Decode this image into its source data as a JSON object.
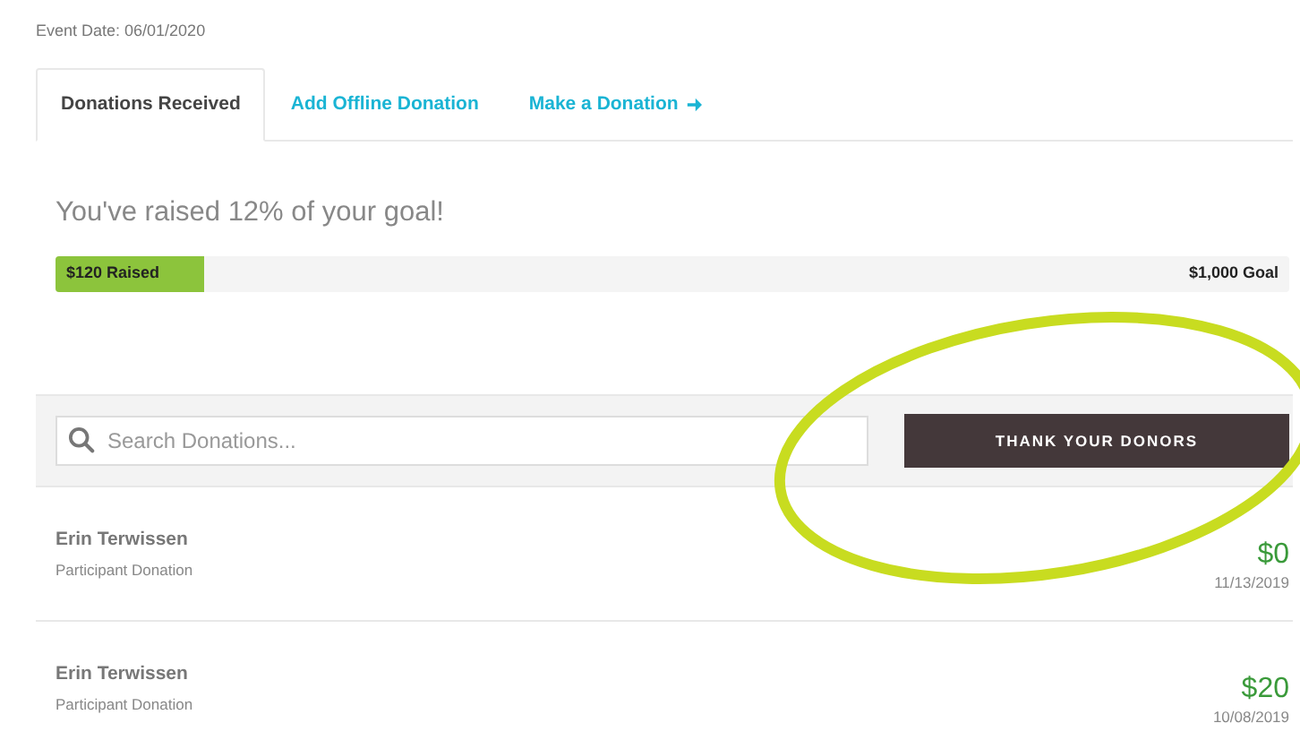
{
  "event_date": "Event Date: 06/01/2020",
  "tabs": [
    {
      "label": "Donations Received",
      "selected": true,
      "kind": "plain"
    },
    {
      "label": "Add Offline Donation",
      "selected": false,
      "kind": "plain"
    },
    {
      "label": "Make a Donation",
      "selected": false,
      "kind": "arrow"
    }
  ],
  "progress": {
    "heading": "You've raised 12% of your goal!",
    "level": 0.12,
    "raised": "$120 Raised",
    "goal": "$1,000 Goal"
  },
  "search": {
    "placeholder": "Search Donations..."
  },
  "thank_button": "THANK YOUR DONORS",
  "donations": [
    {
      "name": "Erin Terwissen",
      "type": "Participant Donation",
      "amount": "$0",
      "date": "11/13/2019"
    },
    {
      "name": "Erin Terwissen",
      "type": "Participant Donation",
      "amount": "$20",
      "date": "10/08/2019"
    }
  ]
}
